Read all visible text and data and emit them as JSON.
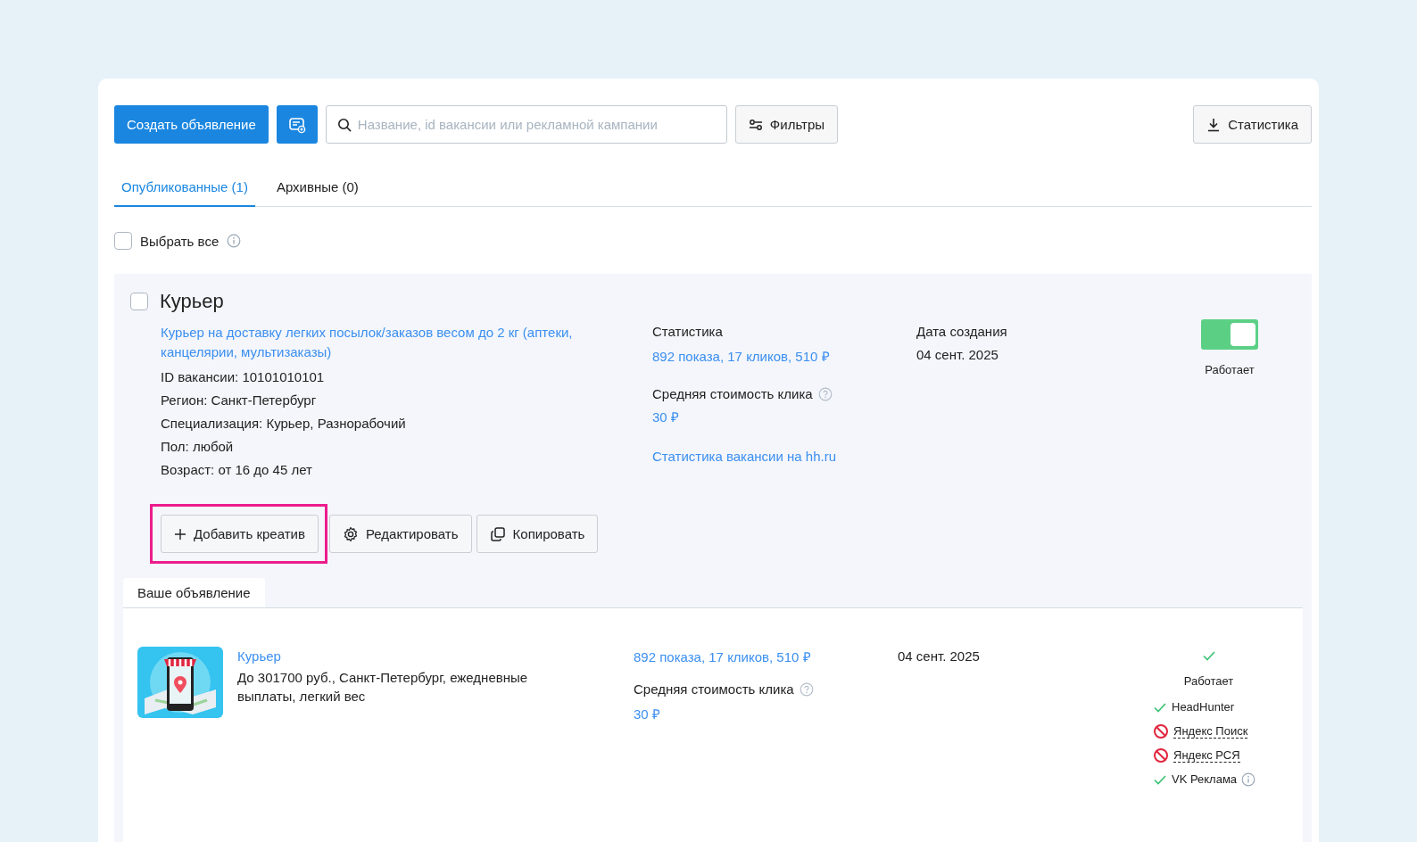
{
  "toolbar": {
    "create_button": "Создать объявление",
    "search": {
      "placeholder": "Название, id вакансии или рекламной кампании"
    },
    "filters_button": "Фильтры",
    "stats_button": "Статистика"
  },
  "tabs": [
    {
      "label": "Опубликованные (1)",
      "selected": true
    },
    {
      "label": "Архивные (0)",
      "selected": false
    }
  ],
  "select_all": {
    "label": "Выбрать все",
    "checked": false
  },
  "vacancy": {
    "title": "Курьер",
    "checked": false,
    "link": "Курьер на доставку легких посылок/заказов весом до 2 кг (аптеки, канцелярии, мультизаказы)",
    "details": [
      "ID вакансии: 10101010101",
      "Регион: Санкт-Петербург",
      "Специализация: Курьер, Разнорабочий",
      "Пол: любой",
      "Возраст: от 16 до 45 лет"
    ],
    "stats": {
      "heading": "Статистика",
      "summary": "892 показа, 17 кликов, 510 ₽",
      "cpc_label": "Средняя стоимость клика",
      "cpc_value": "30 ₽",
      "link": "Статистика вакансии на hh.ru"
    },
    "created": {
      "heading": "Дата создания",
      "date": "04 сент. 2025"
    },
    "status": {
      "on": true,
      "label": "Работает"
    },
    "actions": [
      {
        "kind": "add",
        "label": "Добавить креатив",
        "highlighted": true
      },
      {
        "kind": "edit",
        "label": "Редактировать",
        "highlighted": false
      },
      {
        "kind": "copy",
        "label": "Копировать",
        "highlighted": false
      }
    ]
  },
  "ad_tab": {
    "label": "Ваше объявление"
  },
  "ad": {
    "title": "Курьер",
    "description": "До 301700 руб., Санкт-Петербург, ежедневные выплаты, легкий вес",
    "summary": "892 показа, 17 кликов, 510 ₽",
    "cpc_label": "Средняя стоимость клика",
    "cpc_value": "30 ₽",
    "date": "04 сент. 2025",
    "status_label": "Работает",
    "platforms": [
      {
        "name": "HeadHunter",
        "kind": "ok",
        "info": false
      },
      {
        "name": "Яндекс Поиск",
        "kind": "blocked",
        "info": false
      },
      {
        "name": "Яндекс РСЯ",
        "kind": "blocked",
        "info": false
      },
      {
        "name": "VK Реклама",
        "kind": "ok",
        "info": true
      }
    ]
  }
}
